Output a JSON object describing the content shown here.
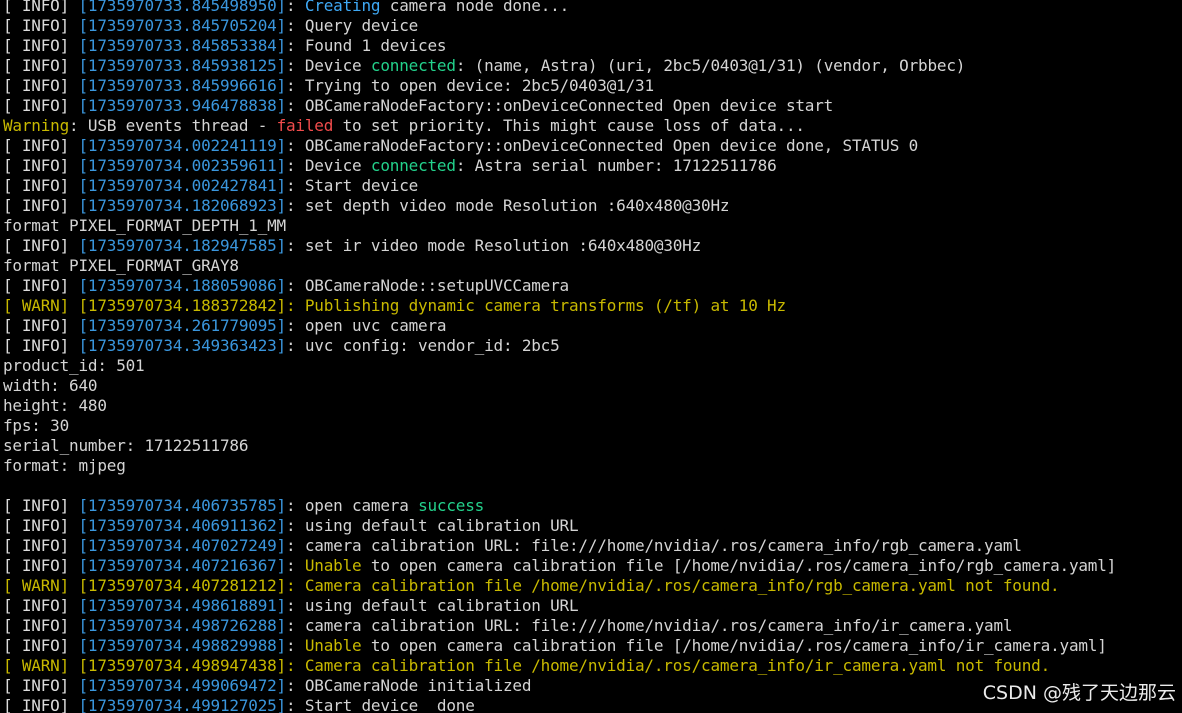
{
  "palette": {
    "background": "#000000",
    "text": "#d4d4d4",
    "timestamp": "#3a96dd",
    "cyan": "#3fa9f5",
    "green": "#23d18b",
    "yellow": "#c8b900",
    "red": "#f14c4c"
  },
  "lines": [
    [
      [
        "[ INFO] ",
        "tag"
      ],
      [
        "[1735970733.845498950]",
        "ts"
      ],
      [
        ": ",
        "text"
      ],
      [
        "Creating",
        "cyan"
      ],
      [
        " camera node done...",
        "text"
      ]
    ],
    [
      [
        "[ INFO] ",
        "tag"
      ],
      [
        "[1735970733.845705204]",
        "ts"
      ],
      [
        ": Query device",
        "text"
      ]
    ],
    [
      [
        "[ INFO] ",
        "tag"
      ],
      [
        "[1735970733.845853384]",
        "ts"
      ],
      [
        ": Found 1 devices",
        "text"
      ]
    ],
    [
      [
        "[ INFO] ",
        "tag"
      ],
      [
        "[1735970733.845938125]",
        "ts"
      ],
      [
        ": Device ",
        "text"
      ],
      [
        "connected",
        "green"
      ],
      [
        ": (name, Astra) (uri, 2bc5/0403@1/31) (vendor, Orbbec)",
        "text"
      ]
    ],
    [
      [
        "[ INFO] ",
        "tag"
      ],
      [
        "[1735970733.845996616]",
        "ts"
      ],
      [
        ": Trying to open device: 2bc5/0403@1/31",
        "text"
      ]
    ],
    [
      [
        "[ INFO] ",
        "tag"
      ],
      [
        "[1735970733.946478838]",
        "ts"
      ],
      [
        ": OBCameraNodeFactory::onDeviceConnected Open device start",
        "text"
      ]
    ],
    [
      [
        "Warning",
        "yellow"
      ],
      [
        ": USB events thread - ",
        "text"
      ],
      [
        "failed",
        "red"
      ],
      [
        " to set priority. This might cause loss of data...",
        "text"
      ]
    ],
    [
      [
        "[ INFO] ",
        "tag"
      ],
      [
        "[1735970734.002241119]",
        "ts"
      ],
      [
        ": OBCameraNodeFactory::onDeviceConnected Open device done, STATUS 0",
        "text"
      ]
    ],
    [
      [
        "[ INFO] ",
        "tag"
      ],
      [
        "[1735970734.002359611]",
        "ts"
      ],
      [
        ": Device ",
        "text"
      ],
      [
        "connected",
        "green"
      ],
      [
        ": Astra serial number: 17122511786",
        "text"
      ]
    ],
    [
      [
        "[ INFO] ",
        "tag"
      ],
      [
        "[1735970734.002427841]",
        "ts"
      ],
      [
        ": Start device",
        "text"
      ]
    ],
    [
      [
        "[ INFO] ",
        "tag"
      ],
      [
        "[1735970734.182068923]",
        "ts"
      ],
      [
        ": set depth video mode Resolution :640x480@30Hz",
        "text"
      ]
    ],
    [
      [
        "format PIXEL_FORMAT_DEPTH_1_MM",
        "text"
      ]
    ],
    [
      [
        "[ INFO] ",
        "tag"
      ],
      [
        "[1735970734.182947585]",
        "ts"
      ],
      [
        ": set ir video mode Resolution :640x480@30Hz",
        "text"
      ]
    ],
    [
      [
        "format PIXEL_FORMAT_GRAY8",
        "text"
      ]
    ],
    [
      [
        "[ INFO] ",
        "tag"
      ],
      [
        "[1735970734.188059086]",
        "ts"
      ],
      [
        ": OBCameraNode::setupUVCCamera",
        "text"
      ]
    ],
    [
      [
        "[ WARN] [1735970734.188372842]: Publishing dynamic camera transforms (/tf) at 10 Hz",
        "warn"
      ]
    ],
    [
      [
        "[ INFO] ",
        "tag"
      ],
      [
        "[1735970734.261779095]",
        "ts"
      ],
      [
        ": open uvc camera",
        "text"
      ]
    ],
    [
      [
        "[ INFO] ",
        "tag"
      ],
      [
        "[1735970734.349363423]",
        "ts"
      ],
      [
        ": uvc config: vendor_id: 2bc5",
        "text"
      ]
    ],
    [
      [
        "product_id: 501",
        "text"
      ]
    ],
    [
      [
        "width: 640",
        "text"
      ]
    ],
    [
      [
        "height: 480",
        "text"
      ]
    ],
    [
      [
        "fps: 30",
        "text"
      ]
    ],
    [
      [
        "serial_number: 17122511786",
        "text"
      ]
    ],
    [
      [
        "format: mjpeg",
        "text"
      ]
    ],
    [
      [
        "",
        "text"
      ]
    ],
    [
      [
        "[ INFO] ",
        "tag"
      ],
      [
        "[1735970734.406735785]",
        "ts"
      ],
      [
        ": open camera ",
        "text"
      ],
      [
        "success",
        "green"
      ]
    ],
    [
      [
        "[ INFO] ",
        "tag"
      ],
      [
        "[1735970734.406911362]",
        "ts"
      ],
      [
        ": using default calibration URL",
        "text"
      ]
    ],
    [
      [
        "[ INFO] ",
        "tag"
      ],
      [
        "[1735970734.407027249]",
        "ts"
      ],
      [
        ": camera calibration URL: file:///home/nvidia/.ros/camera_info/rgb_camera.yaml",
        "text"
      ]
    ],
    [
      [
        "[ INFO] ",
        "tag"
      ],
      [
        "[1735970734.407216367]",
        "ts"
      ],
      [
        ": ",
        "text"
      ],
      [
        "Unable",
        "yellow"
      ],
      [
        " to open camera calibration file [/home/nvidia/.ros/camera_info/rgb_camera.yaml]",
        "text"
      ]
    ],
    [
      [
        "[ WARN] [1735970734.407281212]: Camera calibration file /home/nvidia/.ros/camera_info/rgb_camera.yaml not found.",
        "warn"
      ]
    ],
    [
      [
        "[ INFO] ",
        "tag"
      ],
      [
        "[1735970734.498618891]",
        "ts"
      ],
      [
        ": using default calibration URL",
        "text"
      ]
    ],
    [
      [
        "[ INFO] ",
        "tag"
      ],
      [
        "[1735970734.498726288]",
        "ts"
      ],
      [
        ": camera calibration URL: file:///home/nvidia/.ros/camera_info/ir_camera.yaml",
        "text"
      ]
    ],
    [
      [
        "[ INFO] ",
        "tag"
      ],
      [
        "[1735970734.498829988]",
        "ts"
      ],
      [
        ": ",
        "text"
      ],
      [
        "Unable",
        "yellow"
      ],
      [
        " to open camera calibration file [/home/nvidia/.ros/camera_info/ir_camera.yaml]",
        "text"
      ]
    ],
    [
      [
        "[ WARN] [1735970734.498947438]: Camera calibration file /home/nvidia/.ros/camera_info/ir_camera.yaml not found.",
        "warn"
      ]
    ],
    [
      [
        "[ INFO] ",
        "tag"
      ],
      [
        "[1735970734.499069472]",
        "ts"
      ],
      [
        ": OBCameraNode initialized",
        "text"
      ]
    ],
    [
      [
        "[ INFO] ",
        "tag"
      ],
      [
        "[1735970734.499127025]",
        "ts"
      ],
      [
        ": Start device  done",
        "text"
      ]
    ]
  ],
  "watermark": "CSDN @残了天边那云"
}
